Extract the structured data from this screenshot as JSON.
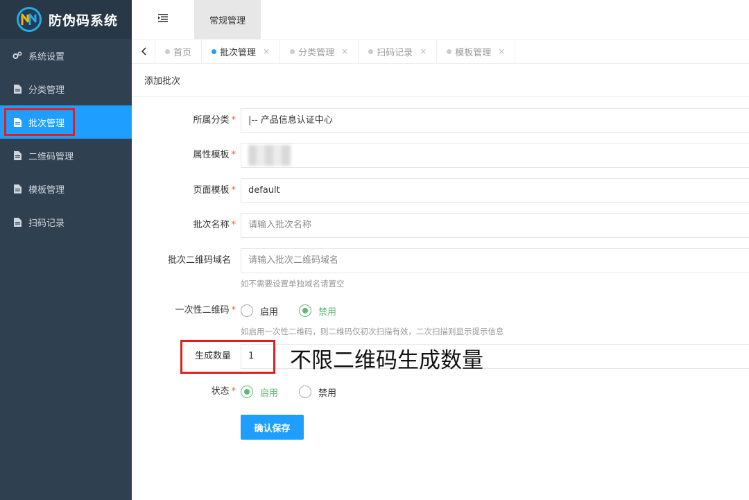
{
  "app": {
    "title": "防伪码系统"
  },
  "sidebar": {
    "items": [
      {
        "label": "系统设置",
        "icon": "gears-icon"
      },
      {
        "label": "分类管理",
        "icon": "file-icon"
      },
      {
        "label": "批次管理",
        "icon": "file-icon",
        "active": true
      },
      {
        "label": "二维码管理",
        "icon": "file-icon"
      },
      {
        "label": "模板管理",
        "icon": "file-icon"
      },
      {
        "label": "扫码记录",
        "icon": "file-icon"
      }
    ]
  },
  "header": {
    "nav_label": "常规管理",
    "toggle_icon": "menu-toggle-icon"
  },
  "tabs": [
    {
      "label": "首页",
      "active": false
    },
    {
      "label": "批次管理",
      "active": true
    },
    {
      "label": "分类管理",
      "active": false
    },
    {
      "label": "扫码记录",
      "active": false
    },
    {
      "label": "模板管理",
      "active": false
    }
  ],
  "tab_close_glyph": "×",
  "panel": {
    "title": "添加批次"
  },
  "form": {
    "category": {
      "label": "所属分类",
      "value": "|-- 产品信息认证中心"
    },
    "attr_template": {
      "label": "属性模板"
    },
    "page_template": {
      "label": "页面模板",
      "value": "default"
    },
    "batch_name": {
      "label": "批次名称",
      "placeholder": "请输入批次名称"
    },
    "domain": {
      "label": "批次二维码域名",
      "placeholder": "请输入批次二维码域名",
      "hint": "如不需要设置单独域名请置空"
    },
    "one_time": {
      "label": "一次性二维码",
      "options": [
        "启用",
        "禁用"
      ],
      "selected": "禁用",
      "hint": "如启用一次性二维码，则二维码仅初次扫描有效，二次扫描则显示提示信息"
    },
    "quantity": {
      "label": "生成数量",
      "value": "1"
    },
    "status": {
      "label": "状态",
      "options": [
        "启用",
        "禁用"
      ],
      "selected": "启用"
    },
    "required_mark": "*",
    "submit_label": "确认保存"
  },
  "annotation": {
    "text": "不限二维码生成数量"
  },
  "colors": {
    "sidebar_bg": "#2f4050",
    "accent": "#1e9fff",
    "radio_green": "#5fb878",
    "highlight_red": "#e02020"
  }
}
